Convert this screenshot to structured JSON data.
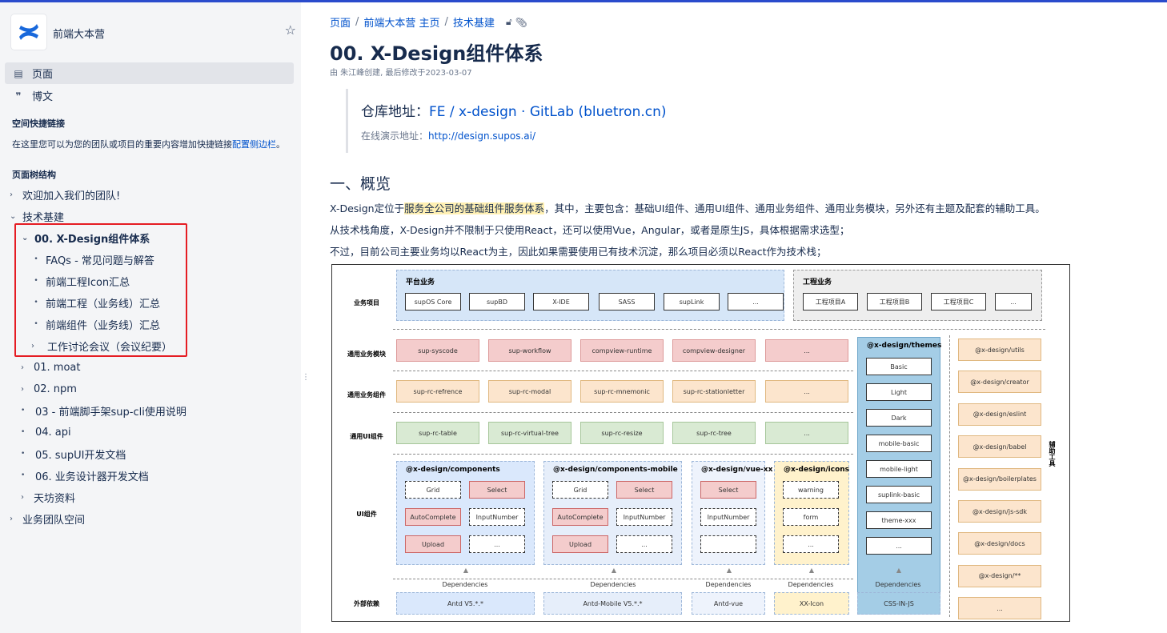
{
  "sidebar": {
    "space_name": "前端大本营",
    "nav": [
      {
        "label": "页面",
        "icon": "page-icon"
      },
      {
        "label": "博文",
        "icon": "quote-icon"
      }
    ],
    "shortcuts_title": "空间快捷链接",
    "shortcuts_text": "在这里您可以为您的团队或项目的重要内容增加快捷链接",
    "shortcuts_link": "配置侧边栏",
    "shortcuts_end": "。",
    "tree_title": "页面树结构",
    "tree": [
      {
        "label": "欢迎加入我们的团队!"
      },
      {
        "label": "技术基建"
      },
      {
        "label": "00. X-Design组件体系"
      },
      {
        "label": "FAQs - 常见问题与解答"
      },
      {
        "label": "前端工程Icon汇总"
      },
      {
        "label": "前端工程（业务线）汇总"
      },
      {
        "label": "前端组件（业务线）汇总"
      },
      {
        "label": "工作讨论会议（会议纪要）"
      },
      {
        "label": "01. moat"
      },
      {
        "label": "02. npm"
      },
      {
        "label": "03 - 前端脚手架sup-cli使用说明"
      },
      {
        "label": "04. api"
      },
      {
        "label": "05. supUI开发文档"
      },
      {
        "label": "06. 业务设计器开发文档"
      },
      {
        "label": "天坊资料"
      },
      {
        "label": "业务团队空间"
      }
    ]
  },
  "main": {
    "breadcrumb": [
      "页面",
      "前端大本营 主页",
      "技术基建"
    ],
    "title": "00. X-Design组件体系",
    "byline": "由 朱江峰创建, 最后修改于2023-03-07",
    "repo_label": "仓库地址：",
    "repo_link": "FE / x-design · GitLab (bluetron.cn)",
    "demo_label": "在线演示地址：",
    "demo_link": "http://design.supos.ai/",
    "section_heading": "一、概览",
    "para1_a": "X-Design定位于",
    "para1_hl": "服务全公司的基础组件服务体系",
    "para1_b": "，其中，主要包含：基础UI组件、通用UI组件、通用业务组件、通用业务模块，另外还有主题及配套的辅助工具。",
    "para2": "从技术栈角度，X-Design并不限制于只使用React，还可以使用Vue，Angular，或者是原生JS，具体根据需求选型；",
    "para3": "不过，目前公司主要业务均以React为主，因此如果需要使用已有技术沉淀，那么项目必须以React作为技术栈；"
  },
  "diagram": {
    "row_labels": [
      "业务项目",
      "通用业务模块",
      "通用业务组件",
      "通用UI组件",
      "UI组件",
      "外部依赖"
    ],
    "platform_title": "平台业务",
    "platform_items": [
      "supOS Core",
      "supBD",
      "X-IDE",
      "SASS",
      "supLink",
      "..."
    ],
    "engineering_title": "工程业务",
    "engineering_items": [
      "工程项目A",
      "工程项目B",
      "工程项目C",
      "..."
    ],
    "modules": [
      "sup-syscode",
      "sup-workflow",
      "compview-runtime",
      "compview-designer",
      "..."
    ],
    "biz_components": [
      "sup-rc-refrence",
      "sup-rc-modal",
      "sup-rc-mnemonic",
      "sup-rc-stationletter",
      "..."
    ],
    "ui_common": [
      "sup-rc-table",
      "sup-rc-virtual-tree",
      "sup-rc-resize",
      "sup-rc-tree",
      "..."
    ],
    "themes_title": "@x-design/themes",
    "themes": [
      "Basic",
      "Light",
      "Dark",
      "mobile-basic",
      "mobile-light",
      "suplink-basic",
      "theme-xxx",
      "..."
    ],
    "tools": [
      "@x-design/utils",
      "@x-design/creator",
      "@x-design/eslint",
      "@x-design/babel",
      "@x-design/boilerplates",
      "@x-design/js-sdk",
      "@x-design/docs",
      "@x-design/**",
      "..."
    ],
    "tools_label": "辅助工具",
    "comp_title": "@x-design/components",
    "comp_items": [
      "Grid",
      "Select",
      "AutoComplete",
      "InputNumber",
      "Upload",
      "..."
    ],
    "mobile_title": "@x-design/components-mobile",
    "mobile_items": [
      "Grid",
      "Select",
      "AutoComplete",
      "InputNumber",
      "Upload",
      "..."
    ],
    "vue_title": "@x-design/vue-xx",
    "vue_items": [
      "Select",
      "InputNumber",
      ""
    ],
    "icons_title": "@x-design/icons",
    "icons_items": [
      "warning",
      "form",
      "..."
    ],
    "deps_label": "Dependencies",
    "externals": [
      "Antd V5.*.*",
      "Antd-Mobile V5.*.*",
      "Antd-vue",
      "XX-Icon",
      "CSS-IN-JS"
    ]
  }
}
